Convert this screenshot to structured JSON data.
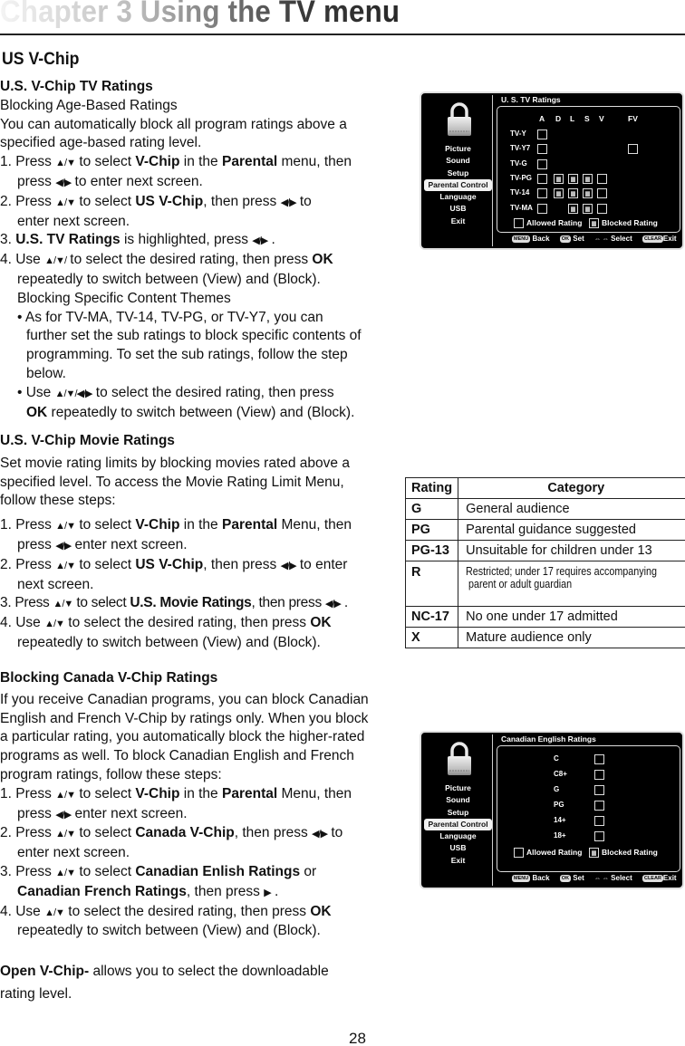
{
  "chapter_title": "Chapter 3 Using the TV menu",
  "section_title": "US V-Chip",
  "tv_ratings": {
    "heading": "U.S. V-Chip TV Ratings",
    "subheading": "Blocking Age-Based Ratings",
    "intro": [
      "You can automatically block all program ratings above a",
      "specified age-based rating level."
    ],
    "steps": [
      {
        "num": "1. ",
        "pre": "Press ",
        "keys": "▲/▼",
        "mid": " to select ",
        "b1": "V-Chip",
        "mid2": " in the ",
        "b2": "Parental",
        "post": " menu, then"
      },
      {
        "cont_pre": "press ",
        "keys": "◀/▶",
        "cont_post": " to enter next screen."
      },
      {
        "num": "2. ",
        "pre": "Press ",
        "keys": "▲/▼",
        "mid": " to select ",
        "b1": "US V-Chip",
        "mid2": ", then press ",
        "keys2": "◀/▶",
        "post": " to"
      },
      {
        "cont": "enter next screen."
      },
      {
        "num": "3. ",
        "b1": "U.S. TV Ratings",
        "mid": " is highlighted, press ",
        "keys": "◀/▶",
        "post": " ."
      },
      {
        "num": "4. ",
        "pre": "Use ",
        "keys": "▲/▼/",
        "mid": " to select the desired rating, then press ",
        "b1": "OK"
      },
      {
        "cont": "repeatedly to switch between (View)  and (Block)."
      },
      {
        "cont": "Blocking Specific Content Themes"
      }
    ],
    "bullets": [
      {
        "lines": [
          "• As for TV-MA, TV-14, TV-PG, or TV-Y7, you can",
          "further set the sub ratings to block specific contents of",
          "programming. To set the sub ratings, follow the step",
          "below."
        ]
      },
      {
        "pre": "• Use ",
        "keys": "▲/▼/◀/▶",
        "post": " to select the desired rating, then press",
        "line2_b": "OK",
        "line2": " repeatedly to switch between (View)  and (Block)."
      }
    ]
  },
  "movie_ratings": {
    "heading": "U.S. V-Chip Movie Ratings",
    "intro": [
      "Set movie rating limits by blocking movies rated above a",
      "specified level. To access the Movie Rating Limit Menu,",
      "follow these steps:"
    ],
    "s1": {
      "num": "1. ",
      "pre": "Press ",
      "keys": "▲/▼",
      "mid": " to select ",
      "b1": "V-Chip",
      "mid2": " in the ",
      "b2": "Parental",
      "post": " Menu, then"
    },
    "s1b": {
      "pre": "press ",
      "keys": "◀/▶",
      "post": " enter next screen."
    },
    "s2": {
      "num": "2. ",
      "pre": "Press ",
      "keys": "▲/▼",
      "mid": " to select ",
      "b1": "US V-Chip",
      "mid2": ", then press ",
      "keys2": "◀/▶",
      "post": " to enter"
    },
    "s2b": "next screen.",
    "s3": {
      "num": "3. ",
      "pre": "Press ",
      "keys": "▲/▼",
      "mid": " to select ",
      "b1": "U.S. Movie Ratings",
      "mid2": ", then press ",
      "keys2": "◀/▶",
      "post": " ."
    },
    "s4": {
      "num": "4. ",
      "pre": "Use ",
      "keys": "▲/▼",
      "mid": " to select the desired rating, then press ",
      "b1": "OK"
    },
    "s4b": "repeatedly to switch between (View)  and (Block)."
  },
  "canada": {
    "heading": "Blocking Canada V-Chip Ratings",
    "intro": [
      "If you receive Canadian programs, you can block Canadian",
      "English and French V-Chip by ratings only. When you block",
      "a particular rating, you automatically block the higher-rated",
      "programs as well. To block Canadian English and French",
      "program ratings, follow these steps:"
    ],
    "s1": {
      "num": "1. ",
      "pre": "Press ",
      "keys": "▲/▼",
      "mid": " to select ",
      "b1": "V-Chip",
      "mid2": " in the ",
      "b2": "Parental",
      "post": " Menu, then"
    },
    "s1b": {
      "pre": "press ",
      "keys": "◀/▶",
      "post": " enter next screen."
    },
    "s2": {
      "num": "2. ",
      "pre": "Press ",
      "keys": "▲/▼",
      "mid": " to select ",
      "b1": "Canada V-Chip",
      "mid2": ", then press ",
      "keys2": "◀/▶",
      "post": " to"
    },
    "s2b": "enter next screen.",
    "s3": {
      "num": "3. ",
      "pre": "Press ",
      "keys": "▲/▼",
      "mid": " to select ",
      "b1": "Canadian Enlish Ratings",
      "post": " or"
    },
    "s3b": {
      "b1": "Canadian French Ratings",
      "mid": ", then press ",
      "keys": "▶",
      "post": " ."
    },
    "s4": {
      "num": "4. ",
      "pre": "Use ",
      "keys": "▲/▼",
      "mid": " to select the desired rating, then press ",
      "b1": "OK"
    },
    "s4b": "repeatedly to switch between (View)  and (Block).",
    "open_b": "Open V-Chip-",
    "open": " allows you to select the downloadable",
    "open2": "rating level."
  },
  "tv_menu": {
    "items": [
      "Picture",
      "Sound",
      "Setup",
      "Parental Control",
      "Language",
      "USB",
      "Exit"
    ],
    "selected": "Parental Control",
    "footer": {
      "menu_key": "MENU",
      "back": "Back",
      "ok_key": "OK",
      "set": "Set",
      "select_keys": "⇔ ⇔",
      "select": "Select",
      "clear_key": "CLEAR",
      "exit": "Exit"
    },
    "legend": {
      "allowed": "Allowed Rating",
      "blocked": "Blocked Rating"
    }
  },
  "us_tv_screen": {
    "title": "U. S. TV Ratings",
    "columns": [
      "A",
      "D",
      "L",
      "S",
      "V",
      "FV"
    ],
    "rows": [
      {
        "label": "TV-Y",
        "cells": [
          "allowed",
          null,
          null,
          null,
          null,
          null
        ]
      },
      {
        "label": "TV-Y7",
        "cells": [
          "allowed",
          null,
          null,
          null,
          null,
          "allowed"
        ]
      },
      {
        "label": "TV-G",
        "cells": [
          "allowed",
          null,
          null,
          null,
          null,
          null
        ]
      },
      {
        "label": "TV-PG",
        "cells": [
          "allowed",
          "blocked",
          "blocked",
          "blocked",
          "allowed",
          null
        ]
      },
      {
        "label": "TV-14",
        "cells": [
          "allowed",
          "blocked",
          "blocked",
          "blocked",
          "allowed",
          null
        ]
      },
      {
        "label": "TV-MA",
        "cells": [
          "allowed",
          null,
          "blocked",
          "blocked",
          "allowed",
          null
        ]
      }
    ]
  },
  "canada_screen": {
    "title": "Canadian English Ratings",
    "rows": [
      {
        "label": "C",
        "state": "allowed"
      },
      {
        "label": "C8+",
        "state": "allowed"
      },
      {
        "label": "G",
        "state": "allowed"
      },
      {
        "label": "PG",
        "state": "allowed"
      },
      {
        "label": "14+",
        "state": "allowed"
      },
      {
        "label": "18+",
        "state": "allowed"
      }
    ]
  },
  "movie_table": {
    "headers": [
      "Rating",
      "Category"
    ],
    "rows": [
      {
        "rating": "G",
        "category": "General audience"
      },
      {
        "rating": "PG",
        "category": "Parental guidance suggested"
      },
      {
        "rating": "PG-13",
        "category": "Unsuitable for children under 13"
      },
      {
        "rating": "R",
        "category": "Restricted; under 17 requires accompanying",
        "category2": " parent or adult guardian"
      },
      {
        "rating": "NC-17",
        "category": "No one under 17 admitted"
      },
      {
        "rating": "X",
        "category": "Mature audience only"
      }
    ]
  },
  "page_number": "28"
}
